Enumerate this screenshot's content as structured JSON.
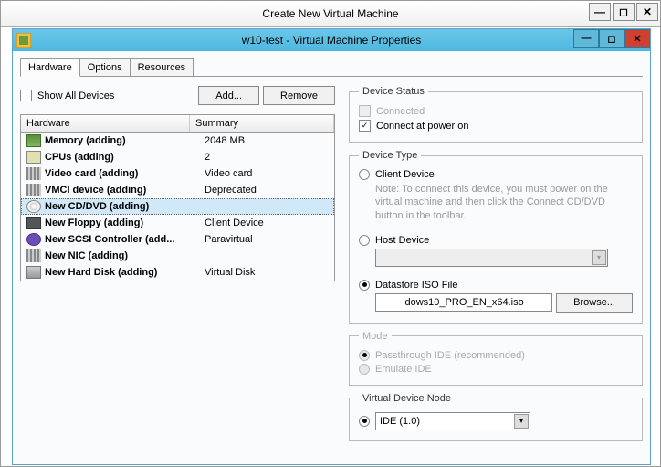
{
  "outer": {
    "title": "Create New Virtual Machine"
  },
  "inner": {
    "title": "w10-test - Virtual Machine Properties"
  },
  "tabs": {
    "hardware": "Hardware",
    "options": "Options",
    "resources": "Resources"
  },
  "left": {
    "show_all": "Show All Devices",
    "add_btn": "Add...",
    "remove_btn": "Remove",
    "col_hw": "Hardware",
    "col_sum": "Summary",
    "rows": [
      {
        "name": "Memory (adding)",
        "summary": "2048 MB",
        "icon": "ico-mem"
      },
      {
        "name": "CPUs (adding)",
        "summary": "2",
        "icon": "ico-cpu"
      },
      {
        "name": "Video card  (adding)",
        "summary": "Video card",
        "icon": "ico-vid"
      },
      {
        "name": "VMCI device (adding)",
        "summary": "Deprecated",
        "icon": "ico-vmci"
      },
      {
        "name": "New CD/DVD (adding)",
        "summary": "",
        "icon": "ico-cd",
        "selected": true
      },
      {
        "name": "New Floppy (adding)",
        "summary": "Client Device",
        "icon": "ico-floppy"
      },
      {
        "name": "New SCSI Controller (add...",
        "summary": "Paravirtual",
        "icon": "ico-scsi"
      },
      {
        "name": "New NIC (adding)",
        "summary": "",
        "icon": "ico-nic"
      },
      {
        "name": "New Hard Disk (adding)",
        "summary": "Virtual Disk",
        "icon": "ico-disk"
      }
    ]
  },
  "right": {
    "status_legend": "Device Status",
    "connected": "Connected",
    "connect_power": "Connect at power on",
    "type_legend": "Device Type",
    "client_device": "Client Device",
    "client_note": "Note: To connect this device, you must power on the virtual machine and then click the Connect CD/DVD button in the toolbar.",
    "host_device": "Host Device",
    "host_value": "",
    "datastore_iso": "Datastore ISO File",
    "iso_value": "dows10_PRO_EN_x64.iso",
    "browse": "Browse...",
    "mode_legend": "Mode",
    "passthrough": "Passthrough IDE (recommended)",
    "emulate": "Emulate IDE",
    "vnode_legend": "Virtual Device Node",
    "vnode_value": "IDE (1:0)"
  }
}
